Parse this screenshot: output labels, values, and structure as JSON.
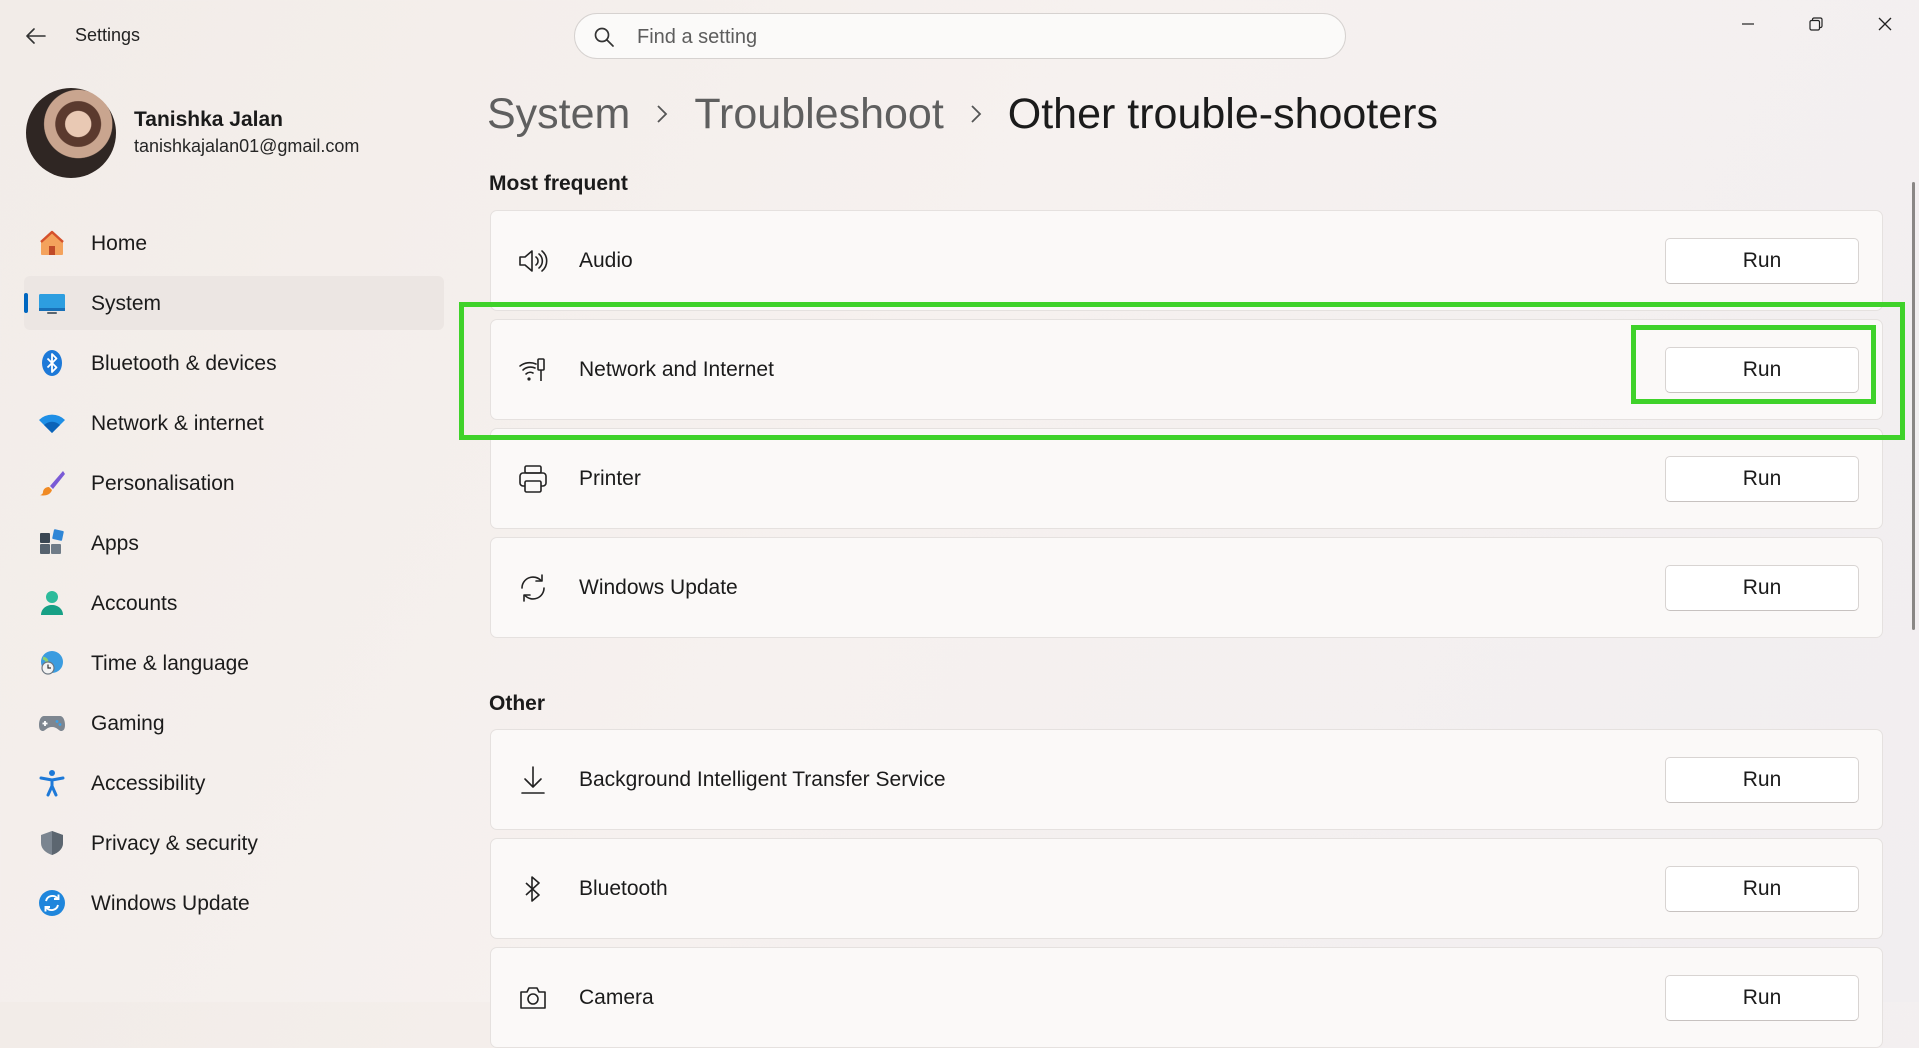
{
  "window": {
    "title": "Settings"
  },
  "search": {
    "placeholder": "Find a setting"
  },
  "profile": {
    "name": "Tanishka Jalan",
    "email": "tanishkajalan01@gmail.com"
  },
  "sidebar": {
    "items": [
      {
        "label": "Home",
        "icon": "home-icon"
      },
      {
        "label": "System",
        "icon": "system-icon",
        "active": true
      },
      {
        "label": "Bluetooth & devices",
        "icon": "bluetooth-icon"
      },
      {
        "label": "Network & internet",
        "icon": "wifi-icon"
      },
      {
        "label": "Personalisation",
        "icon": "brush-icon"
      },
      {
        "label": "Apps",
        "icon": "apps-icon"
      },
      {
        "label": "Accounts",
        "icon": "person-icon"
      },
      {
        "label": "Time & language",
        "icon": "globe-clock-icon"
      },
      {
        "label": "Gaming",
        "icon": "gamepad-icon"
      },
      {
        "label": "Accessibility",
        "icon": "accessibility-icon"
      },
      {
        "label": "Privacy & security",
        "icon": "shield-icon"
      },
      {
        "label": "Windows Update",
        "icon": "update-icon"
      }
    ]
  },
  "breadcrumb": {
    "items": [
      "System",
      "Troubleshoot",
      "Other trouble-shooters"
    ]
  },
  "sections": {
    "most_frequent": {
      "title": "Most frequent",
      "items": [
        {
          "label": "Audio",
          "icon": "speaker-icon",
          "button": "Run"
        },
        {
          "label": "Network and Internet",
          "icon": "network-icon",
          "button": "Run",
          "highlighted": true
        },
        {
          "label": "Printer",
          "icon": "printer-icon",
          "button": "Run"
        },
        {
          "label": "Windows Update",
          "icon": "refresh-icon",
          "button": "Run"
        }
      ]
    },
    "other": {
      "title": "Other",
      "items": [
        {
          "label": "Background Intelligent Transfer Service",
          "icon": "download-icon",
          "button": "Run"
        },
        {
          "label": "Bluetooth",
          "icon": "bluetooth-icon",
          "button": "Run"
        },
        {
          "label": "Camera",
          "icon": "camera-icon",
          "button": "Run"
        }
      ]
    }
  },
  "colors": {
    "accent": "#0067c0",
    "highlight": "#3fd22a"
  }
}
